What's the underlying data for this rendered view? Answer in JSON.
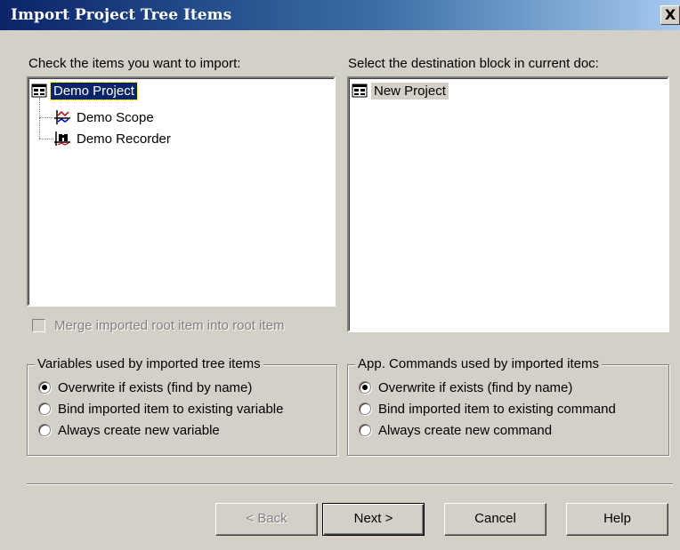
{
  "window": {
    "title": "Import Project Tree Items",
    "close_glyph": "X"
  },
  "left_panel": {
    "label": "Check the items you want to import:",
    "items": [
      {
        "label": "Demo Project",
        "icon": "project-icon",
        "selected": true
      },
      {
        "label": "Demo Scope",
        "icon": "scope-icon"
      },
      {
        "label": "Demo Recorder",
        "icon": "recorder-icon"
      }
    ]
  },
  "right_panel": {
    "label": "Select the destination block in current doc:",
    "items": [
      {
        "label": "New Project",
        "icon": "project-icon",
        "selected": true
      }
    ]
  },
  "merge_checkbox": {
    "label": "Merge imported root item into root item",
    "checked": false,
    "enabled": false
  },
  "variables_group": {
    "title": "Variables used by imported tree items",
    "options": [
      {
        "label": "Overwrite if exists (find by name)",
        "checked": true
      },
      {
        "label": "Bind imported item to existing variable",
        "checked": false
      },
      {
        "label": "Always create new variable",
        "checked": false
      }
    ]
  },
  "commands_group": {
    "title": "App. Commands used by imported items",
    "options": [
      {
        "label": "Overwrite if exists (find by name)",
        "checked": true
      },
      {
        "label": "Bind imported item to existing command",
        "checked": false
      },
      {
        "label": "Always create new command",
        "checked": false
      }
    ]
  },
  "buttons": {
    "back": "< Back",
    "next": "Next >",
    "cancel": "Cancel",
    "help": "Help"
  },
  "colors": {
    "title_start": "#0a246a",
    "title_end": "#a6caf0",
    "face": "#d4d0c8"
  }
}
